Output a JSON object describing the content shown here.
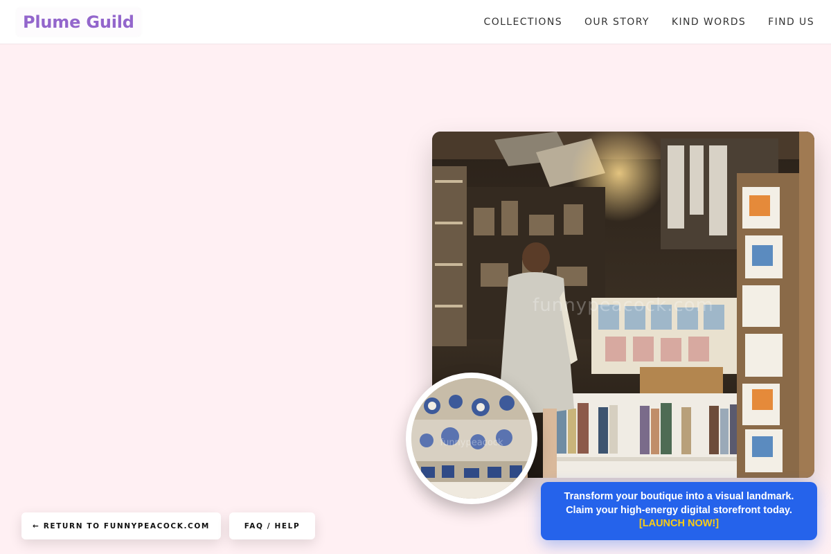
{
  "brand": {
    "name": "Plume Guild",
    "color": "#9366cc"
  },
  "nav": {
    "items": [
      {
        "label": "COLLECTIONS"
      },
      {
        "label": "OUR STORY"
      },
      {
        "label": "KIND WORDS"
      },
      {
        "label": "FIND US"
      }
    ]
  },
  "hero": {
    "photo_desc_icon": "shop-interior-photo",
    "watermark": "funnypeacock.com"
  },
  "inset": {
    "photo_desc_icon": "ceramics-shelf-photo",
    "watermark": "funnypeacock"
  },
  "promo": {
    "line1": "Transform your boutique into a visual landmark.",
    "line2": "Claim your high-energy digital storefront today.",
    "cta": "[LAUNCH NOW!]",
    "bg_color": "#2563eb",
    "cta_color": "#facc15"
  },
  "footer_buttons": {
    "return_label": "← RETURN TO FUNNYPEACOCK.COM",
    "faq_label": "FAQ / HELP"
  },
  "colors": {
    "page_bg": "#fff0f3"
  }
}
